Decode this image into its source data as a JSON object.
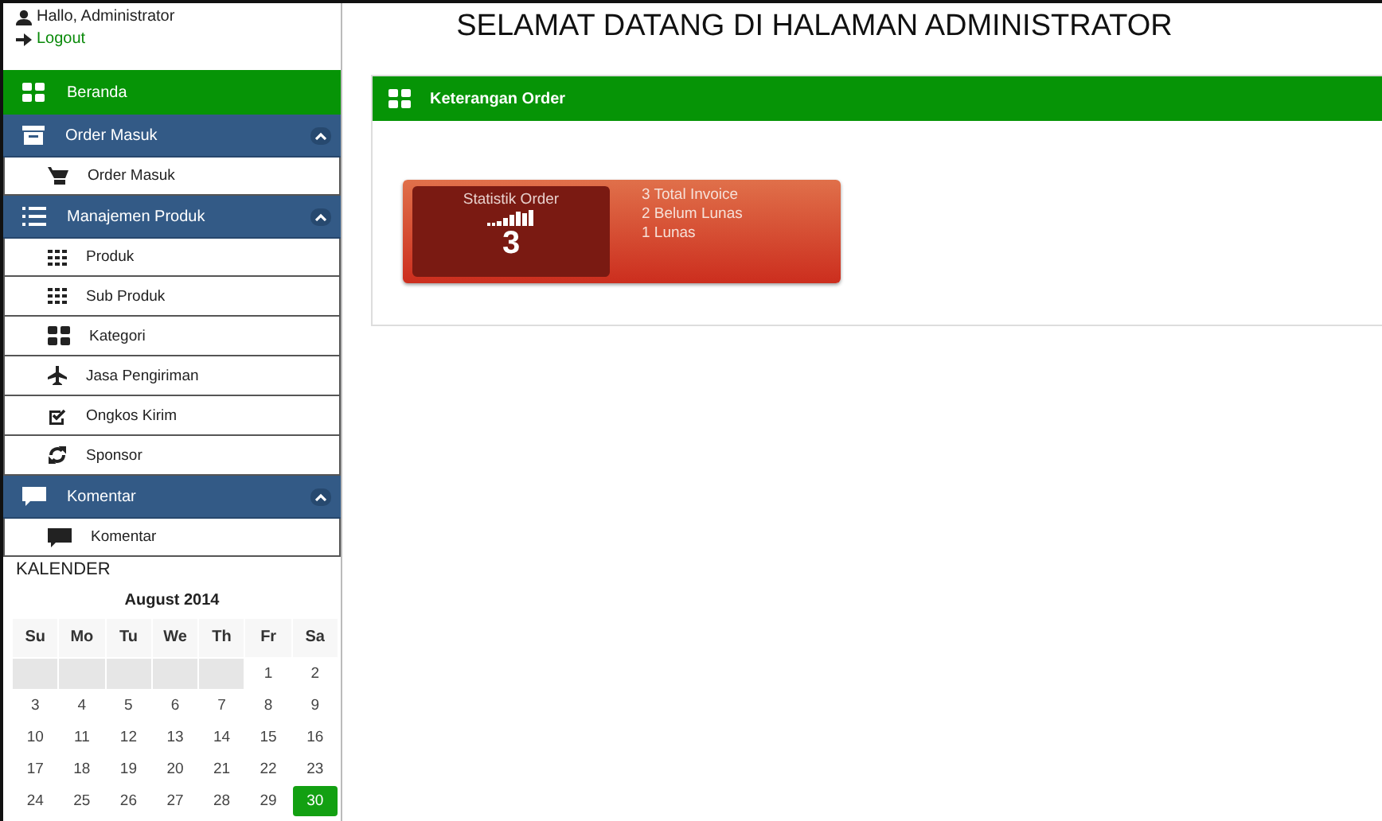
{
  "user": {
    "greeting": "Hallo, Administrator",
    "logout": "Logout"
  },
  "menu": [
    {
      "kind": "home",
      "label": "Beranda"
    },
    {
      "kind": "section",
      "label": "Order Masuk",
      "expanded": true,
      "children": [
        {
          "label": "Order Masuk"
        }
      ]
    },
    {
      "kind": "section",
      "label": "Manajemen Produk",
      "expanded": true,
      "children": [
        {
          "label": "Produk"
        },
        {
          "label": "Sub Produk"
        },
        {
          "label": "Kategori"
        },
        {
          "label": "Jasa Pengiriman"
        },
        {
          "label": "Ongkos Kirim"
        },
        {
          "label": "Sponsor"
        }
      ]
    },
    {
      "kind": "section",
      "label": "Komentar",
      "expanded": true,
      "children": [
        {
          "label": "Komentar"
        }
      ]
    }
  ],
  "calendar": {
    "heading": "KALENDER",
    "month": "August 2014",
    "weekdays": [
      "Su",
      "Mo",
      "Tu",
      "We",
      "Th",
      "Fr",
      "Sa"
    ],
    "weeks": [
      [
        {
          "day": "1",
          "selected": false
        },
        {
          "day": "2",
          "selected": false
        }
      ],
      [
        {
          "day": "3",
          "selected": false
        },
        {
          "day": "4",
          "selected": false
        },
        {
          "day": "5",
          "selected": false
        },
        {
          "day": "6",
          "selected": false
        },
        {
          "day": "7",
          "selected": false
        },
        {
          "day": "8",
          "selected": false
        },
        {
          "day": "9",
          "selected": false
        }
      ],
      [
        {
          "day": "10",
          "selected": false
        },
        {
          "day": "11",
          "selected": false
        },
        {
          "day": "12",
          "selected": false
        },
        {
          "day": "13",
          "selected": false
        },
        {
          "day": "14",
          "selected": false
        },
        {
          "day": "15",
          "selected": false
        },
        {
          "day": "16",
          "selected": false
        }
      ],
      [
        {
          "day": "17",
          "selected": false
        },
        {
          "day": "18",
          "selected": false
        },
        {
          "day": "19",
          "selected": false
        },
        {
          "day": "20",
          "selected": false
        },
        {
          "day": "21",
          "selected": false
        },
        {
          "day": "22",
          "selected": false
        },
        {
          "day": "23",
          "selected": false
        }
      ],
      [
        {
          "day": "24",
          "selected": false
        },
        {
          "day": "25",
          "selected": false
        },
        {
          "day": "26",
          "selected": false
        },
        {
          "day": "27",
          "selected": false
        },
        {
          "day": "28",
          "selected": false
        },
        {
          "day": "29",
          "selected": false
        },
        {
          "day": "30",
          "selected": true
        }
      ]
    ]
  },
  "page_title": "SELAMAT DATANG DI HALAMAN ADMINISTRATOR",
  "panel": {
    "title": "Keterangan Order",
    "stat": {
      "label": "Statistik Order",
      "value": "3",
      "lines": [
        "3 Total Invoice",
        "2 Belum Lunas",
        "1 Lunas"
      ]
    }
  }
}
